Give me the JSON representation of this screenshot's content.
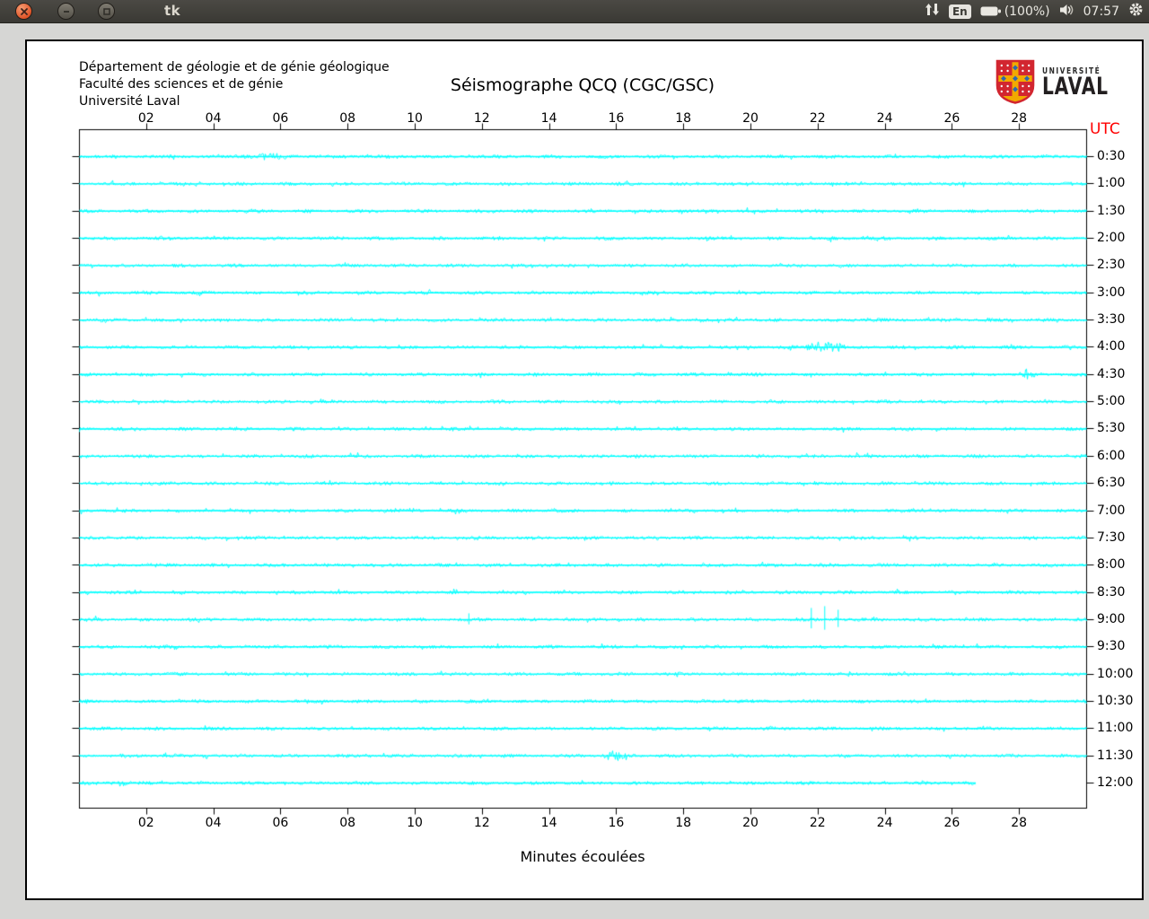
{
  "titlebar": {
    "title": "tk",
    "keyboard_layout": "En",
    "battery_text": "(100%)",
    "clock": "07:57"
  },
  "header": {
    "line1": "Département de géologie et de génie géologique",
    "line2": "Faculté des sciences et de génie",
    "line3": "Université Laval"
  },
  "logo": {
    "small_text": "UNIVERSITÉ",
    "large_text": "LAVAL"
  },
  "chart_data": {
    "type": "line",
    "title": "Séismographe QCQ (CGC/GSC)",
    "xlabel": "Minutes écoulées",
    "y_axis_label": "UTC",
    "x_range_minutes": [
      0,
      30
    ],
    "x_ticks": [
      "02",
      "04",
      "06",
      "08",
      "10",
      "12",
      "14",
      "16",
      "18",
      "20",
      "22",
      "24",
      "26",
      "28"
    ],
    "trace_color": "#00ffff",
    "utc_label_color": "#ff0000",
    "grid": false,
    "traces": [
      {
        "label": "0:30"
      },
      {
        "label": "1:00"
      },
      {
        "label": "1:30"
      },
      {
        "label": "2:00"
      },
      {
        "label": "2:30"
      },
      {
        "label": "3:00"
      },
      {
        "label": "3:30"
      },
      {
        "label": "4:00"
      },
      {
        "label": "4:30"
      },
      {
        "label": "5:00"
      },
      {
        "label": "5:30"
      },
      {
        "label": "6:00"
      },
      {
        "label": "6:30"
      },
      {
        "label": "7:00"
      },
      {
        "label": "7:30"
      },
      {
        "label": "8:00"
      },
      {
        "label": "8:30"
      },
      {
        "label": "9:00"
      },
      {
        "label": "9:30"
      },
      {
        "label": "10:00"
      },
      {
        "label": "10:30"
      },
      {
        "label": "11:00"
      },
      {
        "label": "11:30"
      },
      {
        "label": "12:00",
        "end_min": 26.7
      }
    ],
    "events": [
      {
        "trace": "0:30",
        "kind": "elevated-noise",
        "start_min": 4.4,
        "end_min": 6.6,
        "amplitude": 2.2
      },
      {
        "trace": "4:00",
        "kind": "burst",
        "start_min": 21.6,
        "end_min": 22.8,
        "amplitude": 8
      },
      {
        "trace": "4:30",
        "kind": "burst",
        "start_min": 27.9,
        "end_min": 28.5,
        "amplitude": 4.5
      },
      {
        "trace": "9:00",
        "kind": "impulse-spikes",
        "spikes": [
          {
            "minute": 11.6,
            "amplitude": 7
          },
          {
            "minute": 21.8,
            "amplitude": 13
          },
          {
            "minute": 22.2,
            "amplitude": 15
          },
          {
            "minute": 22.6,
            "amplitude": 11
          }
        ]
      },
      {
        "trace": "11:30",
        "kind": "burst",
        "start_min": 15.5,
        "end_min": 16.4,
        "amplitude": 6
      },
      {
        "trace": "12:00",
        "kind": "burst",
        "start_min": 0.9,
        "end_min": 1.6,
        "amplitude": 3.5
      }
    ]
  }
}
